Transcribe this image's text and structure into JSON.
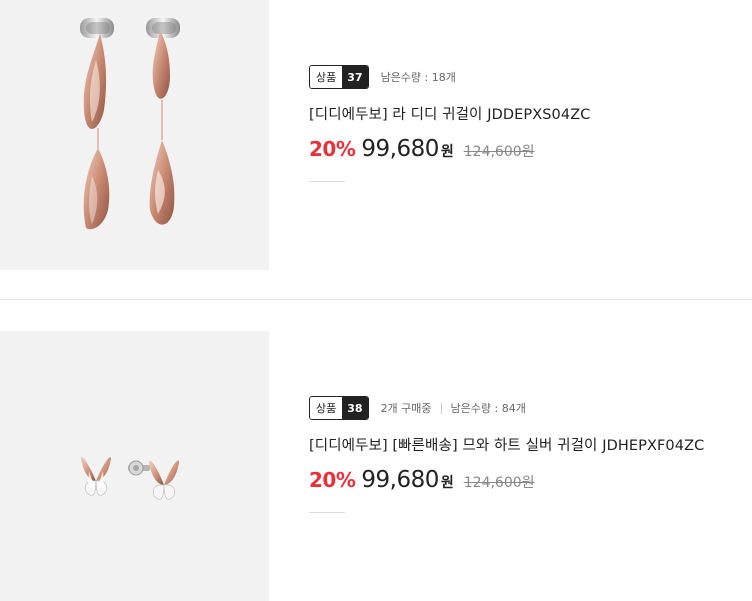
{
  "products": [
    {
      "image_alt": "Rose gold leaf drop earrings",
      "badge_label": "상품",
      "badge_number": "37",
      "meta": [
        "남은수량 : 18개"
      ],
      "title": "[디디에두보] 라 디디 귀걸이 JDDEPXS04ZC",
      "discount": "20%",
      "price": "99,680",
      "currency": "원",
      "original_price": "124,600원"
    },
    {
      "image_alt": "Rose gold heart butterfly stud earrings",
      "badge_label": "상품",
      "badge_number": "38",
      "meta": [
        "2개 구매중",
        "남은수량 : 84개"
      ],
      "title": "[디디에두보] [빠른배송] 므와 하트 실버 귀걸이 JDHEPXF04ZC",
      "discount": "20%",
      "price": "99,680",
      "currency": "원",
      "original_price": "124,600원"
    }
  ],
  "colors": {
    "discount": "#e8323a",
    "badge_bg": "#222222",
    "thumb_bg": "#f2f2f2",
    "rose_gold": "#c98a72"
  }
}
